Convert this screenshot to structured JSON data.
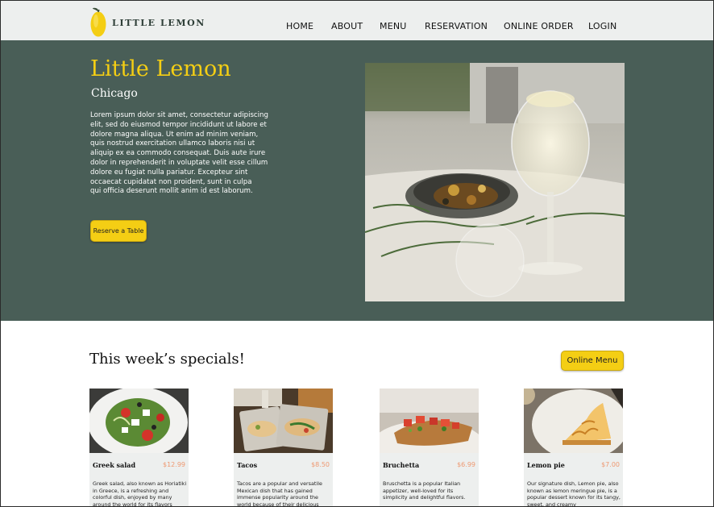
{
  "nav": {
    "brand": "LITTLE LEMON",
    "links": [
      "HOME",
      "ABOUT",
      "MENU",
      "RESERVATION",
      "ONLINE ORDER",
      "LOGIN"
    ]
  },
  "hero": {
    "title": "Little Lemon",
    "subtitle": "Chicago",
    "description": "Lorem ipsum dolor sit amet, consectetur adipiscing\nelit, sed do eiusmod tempor incididunt ut labore et\ndolore magna aliqua. Ut enim ad minim veniam,\nquis nostrud exercitation ullamco laboris nisi ut\naliquip ex ea commodo consequat. Duis aute irure\n dolor in reprehenderit in voluptate velit esse cillum\n dolore eu fugiat nulla pariatur. Excepteur sint\noccaecat cupidatat non proident, sunt in culpa\nqui officia deserunt mollit anim id est laborum.",
    "button": "Reserve a Table"
  },
  "specials": {
    "title": "This week’s specials!",
    "button": "Online Menu",
    "items": [
      {
        "name": "Greek salad",
        "price": "$12.99",
        "description": "Greek salad, also known as Horiatiki in Greece, is a refreshing and colorful dish, enjoyed by many around the world for its flavors"
      },
      {
        "name": "Tacos",
        "price": "$8.50",
        "description": "Tacos are a popular and versatile Mexican dish that has gained immense popularity around the world because of their delicious"
      },
      {
        "name": "Bruchetta",
        "price": "$6.99",
        "description": "Bruschetta is a popular Italian appetizer, well-loved for its simplicity and delightful flavors."
      },
      {
        "name": "Lemon pie",
        "price": "$7.00",
        "description": "Our signature dish, Lemon pie, also known as lemon meringue pie, is a popular dessert known for its tangy, sweet, and creamy"
      }
    ]
  },
  "colors": {
    "primary_green": "#495e57",
    "primary_yellow": "#f4ce14",
    "price_orange": "#ee9972",
    "light_gray": "#edefee"
  }
}
